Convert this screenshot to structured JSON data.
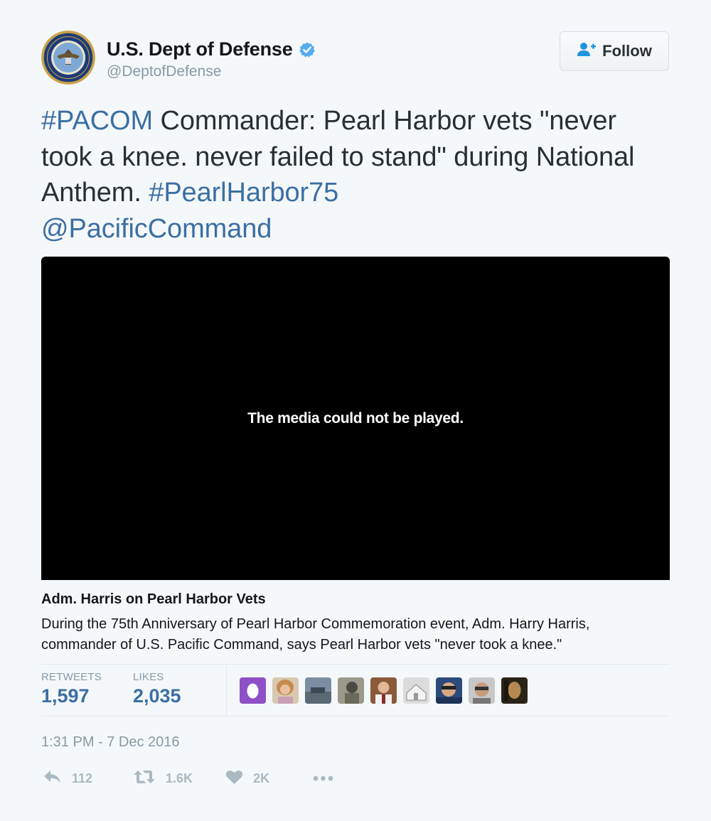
{
  "author": {
    "name": "U.S. Dept of Defense",
    "handle": "@DeptofDefense",
    "verified": true
  },
  "follow_button": {
    "label": "Follow",
    "icon": "add-user-icon"
  },
  "tweet": {
    "segments": [
      {
        "text": "#PACOM",
        "link": true
      },
      {
        "text": " Commander: Pearl Harbor vets \"never took a knee. never failed to stand\" during National Anthem. ",
        "link": false
      },
      {
        "text": "#PearlHarbor75",
        "link": true
      },
      {
        "text": " ",
        "link": false
      },
      {
        "text": "@PacificCommand",
        "link": true
      }
    ]
  },
  "media": {
    "message": "The media could not be played."
  },
  "card": {
    "title": "Adm. Harris on Pearl Harbor Vets",
    "description": "During the 75th Anniversary of Pearl Harbor Commemoration event, Adm. Harry Harris, commander of U.S. Pacific Command, says Pearl Harbor vets \"never took a knee.\""
  },
  "stats": {
    "retweets_label": "RETWEETS",
    "retweets_value": "1,597",
    "likes_label": "LIKES",
    "likes_value": "2,035"
  },
  "likers": [
    {
      "name": "liker-avatar-egg"
    },
    {
      "name": "liker-avatar-2"
    },
    {
      "name": "liker-avatar-3"
    },
    {
      "name": "liker-avatar-4"
    },
    {
      "name": "liker-avatar-5"
    },
    {
      "name": "liker-avatar-6"
    },
    {
      "name": "liker-avatar-7"
    },
    {
      "name": "liker-avatar-8"
    },
    {
      "name": "liker-avatar-9"
    }
  ],
  "timestamp": "1:31 PM - 7 Dec 2016",
  "actions": {
    "reply_count": "112",
    "retweet_count": "1.6K",
    "like_count": "2K"
  },
  "colors": {
    "link": "#3b6fa3",
    "verified": "#1da1f2",
    "muted": "#8899a6",
    "action": "#aab8c2"
  }
}
